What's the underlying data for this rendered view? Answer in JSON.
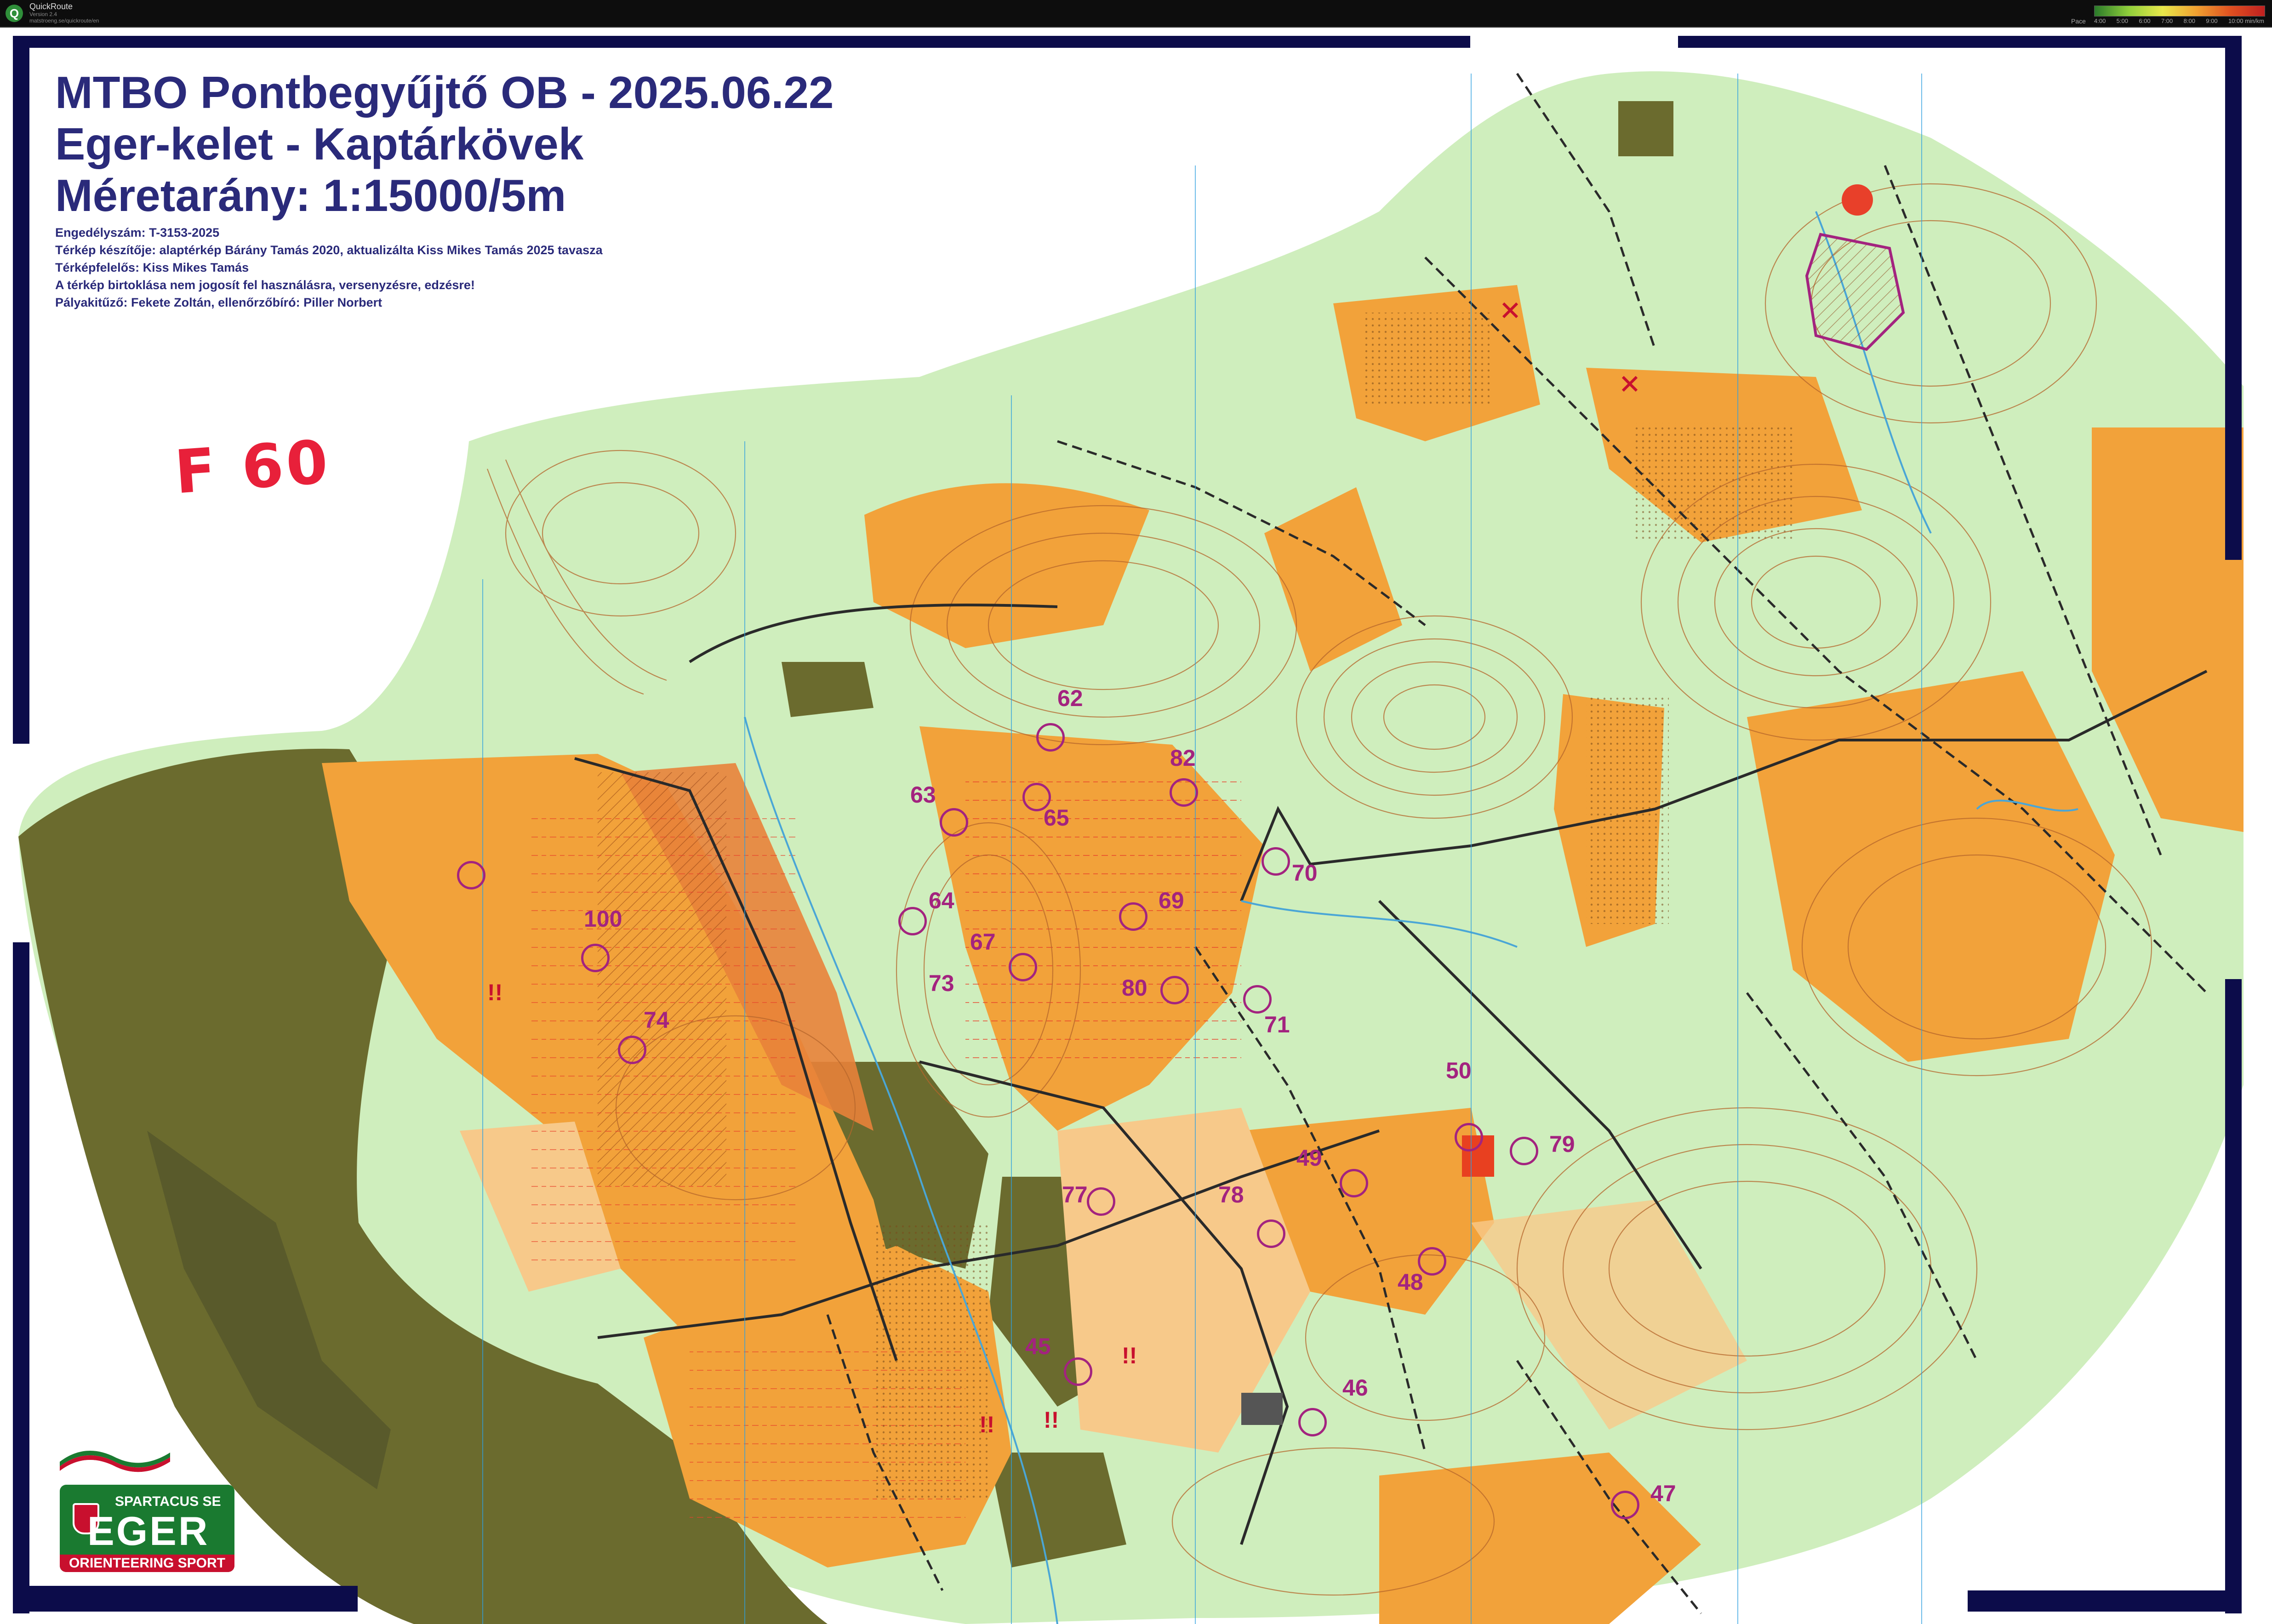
{
  "app": {
    "icon_letter": "Q",
    "name": "QuickRoute",
    "version": "Version 2.4",
    "url": "matstroeng.se/quickroute/en",
    "pace_label": "Pace",
    "pace_ticks": [
      "4:00",
      "5:00",
      "6:00",
      "7:00",
      "8:00",
      "9:00",
      "10:00 min/km"
    ]
  },
  "map": {
    "title_line1": "MTBO Pontbegyűjtő OB - 2025.06.22",
    "title_line2": "Eger-kelet - Kaptárkövek",
    "title_line3": "Méretarány: 1:15000/5m",
    "permit": "Engedélyszám: T-3153-2025",
    "maker": "Térkép készítője: alaptérkép Bárány Tamás 2020, aktualizálta Kiss Mikes Tamás 2025 tavasza",
    "responsible": "Térképfelelős: Kiss Mikes Tamás",
    "notice": "A térkép birtoklása nem jogosít fel használásra, versenyzésre, edzésre!",
    "officials": "Pályakitűző: Fekete Zoltán, ellenőrzőbíró: Piller Norbert",
    "handwritten_category": "F 60",
    "warning_marks": [
      "!!",
      "!!",
      "!!",
      "!!"
    ]
  },
  "controls": [
    {
      "code": "62"
    },
    {
      "code": "82"
    },
    {
      "code": "63"
    },
    {
      "code": "65"
    },
    {
      "code": "70"
    },
    {
      "code": "100"
    },
    {
      "code": "64"
    },
    {
      "code": "69"
    },
    {
      "code": "67"
    },
    {
      "code": "73"
    },
    {
      "code": "80"
    },
    {
      "code": "71"
    },
    {
      "code": "74"
    },
    {
      "code": "50"
    },
    {
      "code": "79"
    },
    {
      "code": "49"
    },
    {
      "code": "78"
    },
    {
      "code": "77"
    },
    {
      "code": "48"
    },
    {
      "code": "45"
    },
    {
      "code": "46"
    },
    {
      "code": "47"
    }
  ],
  "logo": {
    "club": "SPARTACUS SE",
    "city": "EGER",
    "sport": "ORIENTEERING SPORT"
  },
  "colors": {
    "open_land": "#f2a23a",
    "rough_open": "#f7c98a",
    "forest_green": "#cfeebd",
    "dense_green": "#6b6b2e",
    "contour_brown": "#b5652b",
    "course_purple": "#a3237f",
    "frame_navy": "#0c0c4a",
    "title_blue": "#2a2a7a",
    "note_red": "#e8203a",
    "water_blue": "#4aa6d6"
  }
}
